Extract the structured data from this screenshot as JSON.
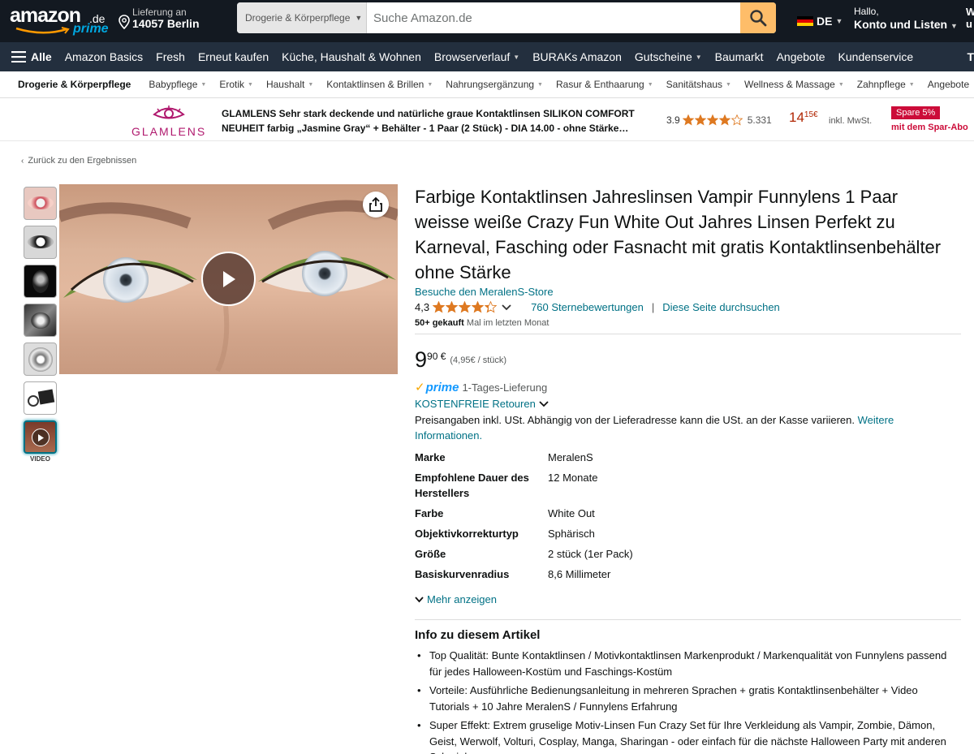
{
  "header": {
    "logo_word": "amazon",
    "logo_tld": ".de",
    "logo_sub": "prime",
    "deliver_line1": "Lieferung an",
    "deliver_line2": "14057 Berlin",
    "search_dept": "Drogerie & Körperpflege",
    "search_placeholder": "Suche Amazon.de",
    "lang": "DE",
    "account_line1": "Hallo,",
    "account_line2": "Konto und Listen",
    "orders_trunc_1": "W",
    "orders_trunc_2": "u"
  },
  "main_nav": {
    "all_label": "Alle",
    "items": [
      "Amazon Basics",
      "Fresh",
      "Erneut kaufen",
      "Küche, Haushalt & Wohnen",
      "Browserverlauf",
      "BURAKs Amazon",
      "Gutscheine",
      "Baumarkt",
      "Angebote",
      "Kundenservice"
    ],
    "trailing": "T"
  },
  "sub_nav": {
    "category": "Drogerie & Körperpflege",
    "items": [
      "Babypflege",
      "Erotik",
      "Haushalt",
      "Kontaktlinsen & Brillen",
      "Nahrungsergänzung",
      "Rasur & Enthaarung",
      "Sanitätshaus",
      "Wellness & Massage",
      "Zahnpflege",
      "Angebote"
    ]
  },
  "banner": {
    "brand": "GLAMLENS",
    "title": "GLAMLENS Sehr stark deckende und natürliche graue Kontaktlinsen SILIKON COMFORT NEUHEIT farbig „Jasmine Gray“ + Behälter - 1 Paar (2 Stück) - DIA 14.00 - ohne Stärke…",
    "rating": "3.9",
    "rating_value": 3.9,
    "review_count": "5.331",
    "price_whole": "14",
    "price_frac": "15",
    "price_currency": "€",
    "vat": "inkl. MwSt.",
    "save_badge": "Spare 5%",
    "save_text": "mit dem Spar-Abo"
  },
  "breadcrumb": {
    "back_label": "Zurück zu den Ergebnissen"
  },
  "gallery": {
    "video_label": "VIDEO",
    "thumbnail_count": 7
  },
  "product": {
    "title": "Farbige Kontaktlinsen Jahreslinsen Vampir Funnylens 1 Paar weisse weiße Crazy Fun White Out Jahres Linsen Perfekt zu Karneval, Fasching oder Fasnacht mit gratis Kontaktlinsenbehälter ohne Stärke",
    "store_link": "Besuche den MeralenS-Store",
    "rating": "4,3",
    "rating_value": 4.3,
    "ratings_link": "760 Sternebewertungen",
    "search_page_link": "Diese Seite durchsuchen",
    "bought_bold": "50+ gekauft",
    "bought_rest": "Mal im letzten Monat",
    "price_whole": "9",
    "price_frac": "90 €",
    "price_unit": "(4,95€ / stück)",
    "prime_word": "prime",
    "delivery": "1-Tages-Lieferung",
    "returns": "KOSTENFREIE Retouren",
    "vat_note": "Preisangaben inkl. USt. Abhängig von der Lieferadresse kann die USt. an der Kasse variieren.",
    "vat_link": "Weitere Informationen.",
    "specs": [
      {
        "k": "Marke",
        "v": "MeralenS"
      },
      {
        "k": "Empfohlene Dauer des Herstellers",
        "v": "12 Monate"
      },
      {
        "k": "Farbe",
        "v": "White Out"
      },
      {
        "k": "Objektivkorrekturtyp",
        "v": "Sphärisch"
      },
      {
        "k": "Größe",
        "v": "2 stück (1er Pack)"
      },
      {
        "k": "Basiskurvenradius",
        "v": "8,6 Millimeter"
      }
    ],
    "more_link": "Mehr anzeigen",
    "about_heading": "Info zu diesem Artikel",
    "about": [
      "Top Qualität: Bunte Kontaktlinsen / Motivkontaktlinsen Markenprodukt / Markenqualität von Funnylens passend für jedes Halloween-Kostüm und Faschings-Kostüm",
      "Vorteile: Ausführliche Bedienungsanleitung in mehreren Sprachen + gratis Kontaktlinsenbehälter + Video Tutorials + 10 Jahre MeralenS / Funnylens Erfahrung",
      "Super Effekt: Extrem gruselige Motiv-Linsen Fun Crazy Set für Ihre Verkleidung als Vampir, Zombie, Dämon, Geist, Werwolf, Volturi, Cosplay, Manga, Sharingan - oder einfach für die nächste Halloween Party mit anderen Schminke"
    ]
  },
  "colors": {
    "nav_dark": "#131921",
    "nav_mid": "#232f3e",
    "search_button": "#febd69",
    "link": "#007185",
    "star": "#de7921",
    "price_red": "#b12704",
    "prime_blue": "#1399ff"
  }
}
